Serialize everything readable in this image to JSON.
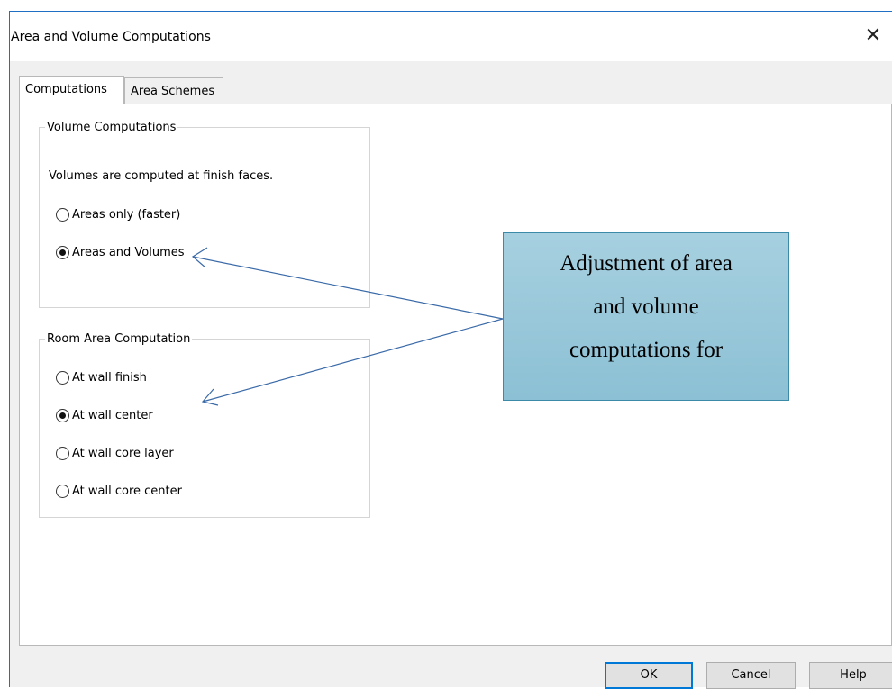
{
  "window": {
    "title": "Area and Volume Computations",
    "close_glyph": "✕"
  },
  "tabs": [
    {
      "label": "Computations",
      "selected": true
    },
    {
      "label": "Area Schemes",
      "selected": false
    }
  ],
  "volume_group": {
    "legend": "Volume Computations",
    "description": "Volumes are computed at finish faces.",
    "options": [
      {
        "label": "Areas only (faster)",
        "checked": false
      },
      {
        "label": "Areas and Volumes",
        "checked": true
      }
    ]
  },
  "room_group": {
    "legend": "Room Area Computation",
    "options": [
      {
        "label": "At wall finish",
        "checked": false
      },
      {
        "label": "At wall center",
        "checked": true
      },
      {
        "label": "At wall core layer",
        "checked": false
      },
      {
        "label": "At wall core center",
        "checked": false
      }
    ]
  },
  "callout": {
    "lines": [
      "Adjustment of area",
      "and volume",
      "computations for"
    ]
  },
  "buttons": {
    "ok": "OK",
    "cancel": "Cancel",
    "help": "Help"
  },
  "colors": {
    "callout_fill": "#9fcadb",
    "callout_border": "#3b8aa8",
    "arrow": "#3a6aa8",
    "ok_focus_border": "#0078d7",
    "window_border": "#1f6fc5"
  }
}
